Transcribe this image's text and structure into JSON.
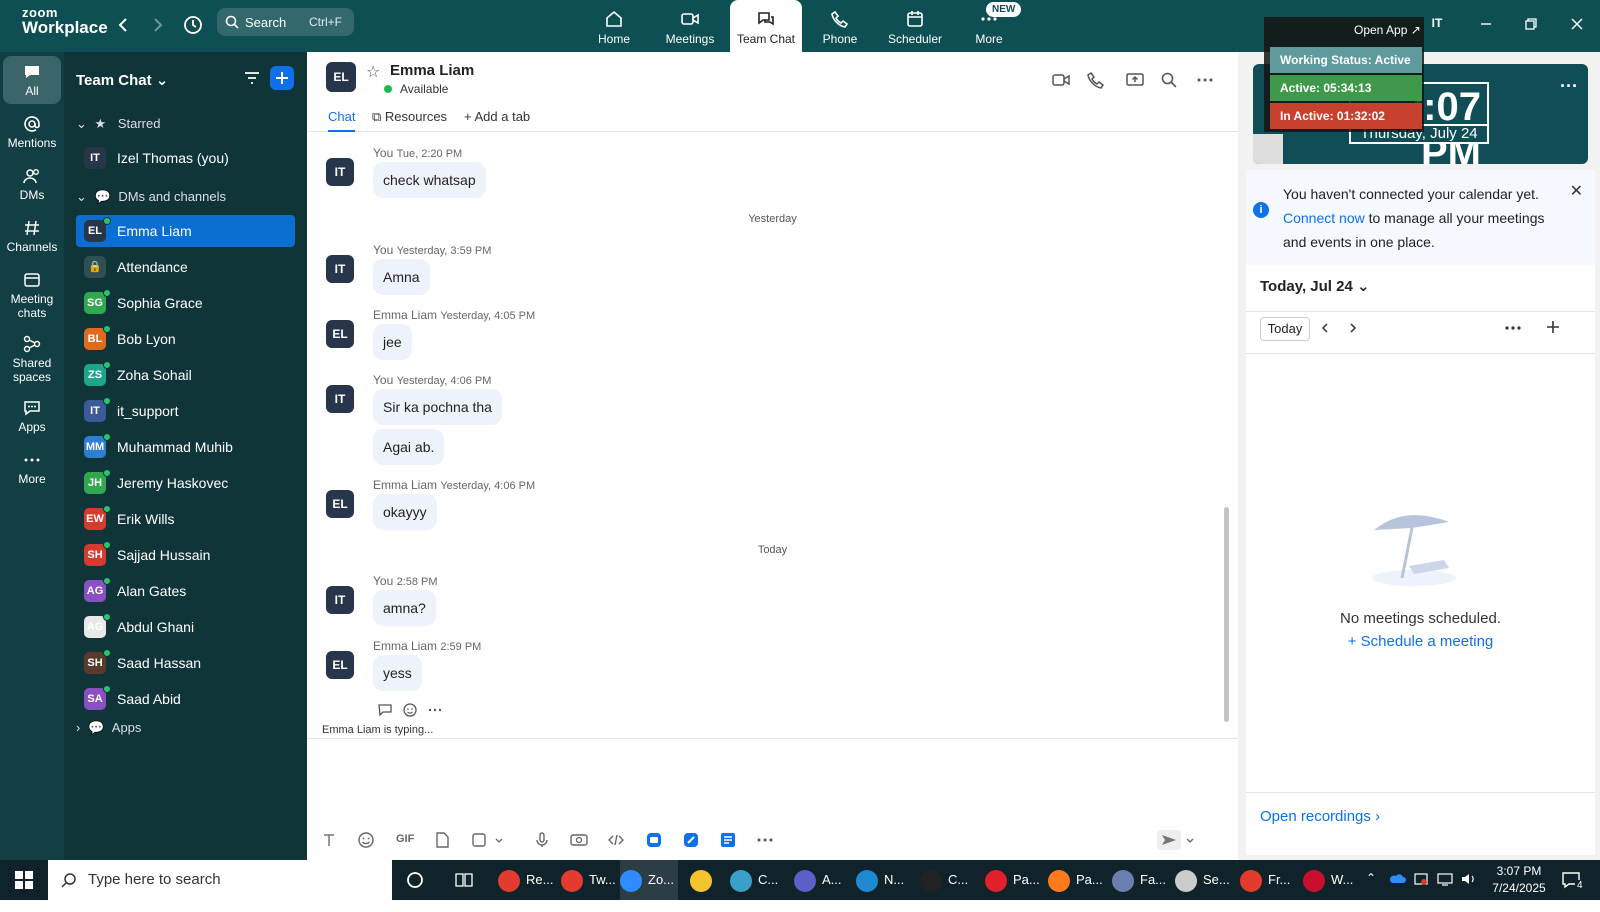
{
  "app": {
    "logo_top": "zoom",
    "logo_bottom": "Workplace"
  },
  "top_search": {
    "label": "Search",
    "shortcut": "Ctrl+F"
  },
  "top_tabs": [
    {
      "label": "Home"
    },
    {
      "label": "Meetings"
    },
    {
      "label": "Team Chat"
    },
    {
      "label": "Phone"
    },
    {
      "label": "Scheduler"
    },
    {
      "label": "More"
    }
  ],
  "new_badge": "NEW",
  "user_initials": "IT",
  "overlay": {
    "open_app": "Open App ↗",
    "working_status": "Working Status: Active",
    "active": "Active: 05:34:13",
    "inactive": "In Active: 01:32:02"
  },
  "clock": {
    "time": "3:07 PM",
    "date": "Thursday, July 24"
  },
  "rail": [
    {
      "label": "All"
    },
    {
      "label": "Mentions"
    },
    {
      "label": "DMs"
    },
    {
      "label": "Channels"
    },
    {
      "label": "Meeting chats"
    },
    {
      "label": "Shared spaces"
    },
    {
      "label": "Apps"
    },
    {
      "label": "More"
    }
  ],
  "sidebar": {
    "title": "Team Chat",
    "starred_label": "Starred",
    "starred_item": {
      "initials": "IT",
      "name": "Izel Thomas (you)"
    },
    "dms_label": "DMs and channels",
    "apps_label": "Apps",
    "items": [
      {
        "initials": "EL",
        "name": "Emma Liam",
        "color": "#27364a"
      },
      {
        "initials": "🔒",
        "name": "Attendance",
        "color": "#2f4f52"
      },
      {
        "initials": "SG",
        "name": "Sophia Grace",
        "color": "#2fa84f"
      },
      {
        "initials": "BL",
        "name": "Bob Lyon",
        "color": "#e06b1f"
      },
      {
        "initials": "ZS",
        "name": "Zoha Sohail",
        "color": "#1fa58c"
      },
      {
        "initials": "IT",
        "name": "it_support",
        "color": "#3a5a9a"
      },
      {
        "initials": "MM",
        "name": "Muhammad Muhib",
        "color": "#2d7fd0"
      },
      {
        "initials": "JH",
        "name": "Jeremy Haskovec",
        "color": "#2fa84f"
      },
      {
        "initials": "EW",
        "name": "Erik Wills",
        "color": "#d63b2f"
      },
      {
        "initials": "SH",
        "name": "Sajjad Hussain",
        "color": "#d63b2f"
      },
      {
        "initials": "AG",
        "name": "Alan Gates",
        "color": "#8a4fc2"
      },
      {
        "initials": "AG",
        "name": "Abdul Ghani",
        "color": "#e8e8e8"
      },
      {
        "initials": "SH",
        "name": "Saad Hassan",
        "color": "#5a3a2a"
      },
      {
        "initials": "SA",
        "name": "Saad Abid",
        "color": "#8a4fc2"
      }
    ]
  },
  "chat": {
    "contact_initials": "EL",
    "contact_name": "Emma Liam",
    "contact_status": "Available",
    "tabs": {
      "chat": "Chat",
      "resources": "Resources",
      "add": "Add a tab"
    },
    "day_yesterday": "Yesterday",
    "day_today": "Today",
    "messages": [
      {
        "initials": "IT",
        "sender": "You",
        "time": "Tue, 2:20 PM",
        "text": "check whatsap"
      },
      {
        "initials": "IT",
        "sender": "You",
        "time": "Yesterday, 3:59 PM",
        "text": "Amna"
      },
      {
        "initials": "EL",
        "sender": "Emma Liam",
        "time": "Yesterday, 4:05 PM",
        "text": "jee"
      },
      {
        "initials": "IT",
        "sender": "You",
        "time": "Yesterday, 4:06 PM",
        "text": "Sir ka pochna tha",
        "text2": "Agai ab."
      },
      {
        "initials": "EL",
        "sender": "Emma Liam",
        "time": "Yesterday, 4:06 PM",
        "text": "okayyy"
      },
      {
        "initials": "IT",
        "sender": "You",
        "time": "2:58 PM",
        "text": "amna?"
      },
      {
        "initials": "EL",
        "sender": "Emma Liam",
        "time": "2:59 PM",
        "text": "yess"
      }
    ],
    "typing": "Emma Liam  is typing...",
    "gif_label": "GIF"
  },
  "calendar": {
    "notice_pre": "You haven't connected your calendar yet. ",
    "notice_link": "Connect now",
    "notice_post": " to manage all your meetings and events in one place.",
    "today_title": "Today, Jul 24",
    "today_button": "Today",
    "no_meetings": "No meetings scheduled.",
    "schedule_link": "+ Schedule a meeting",
    "open_recordings": "Open recordings  ›"
  },
  "taskbar": {
    "search_placeholder": "Type here to search",
    "apps": [
      {
        "label": "Re...",
        "color": "#e33b2e"
      },
      {
        "label": "Tw...",
        "color": "#e33b2e"
      },
      {
        "label": "Zo...",
        "color": "#2d8cff"
      },
      {
        "label": "",
        "color": "#f4c430"
      },
      {
        "label": "C...",
        "color": "#3aa0c8"
      },
      {
        "label": "A...",
        "color": "#5b5fc7"
      },
      {
        "label": "N...",
        "color": "#1f8ad2"
      },
      {
        "label": "C...",
        "color": "#222222"
      },
      {
        "label": "Pa...",
        "color": "#e0202a"
      },
      {
        "label": "Pa...",
        "color": "#ff7a1a"
      },
      {
        "label": "Fa...",
        "color": "#6a7fb0"
      },
      {
        "label": "Se...",
        "color": "#cccccc"
      },
      {
        "label": "Fr...",
        "color": "#e33b2e"
      },
      {
        "label": "W...",
        "color": "#c8102e"
      }
    ],
    "time": "3:07 PM",
    "date": "7/24/2025",
    "notif_count": "4"
  }
}
